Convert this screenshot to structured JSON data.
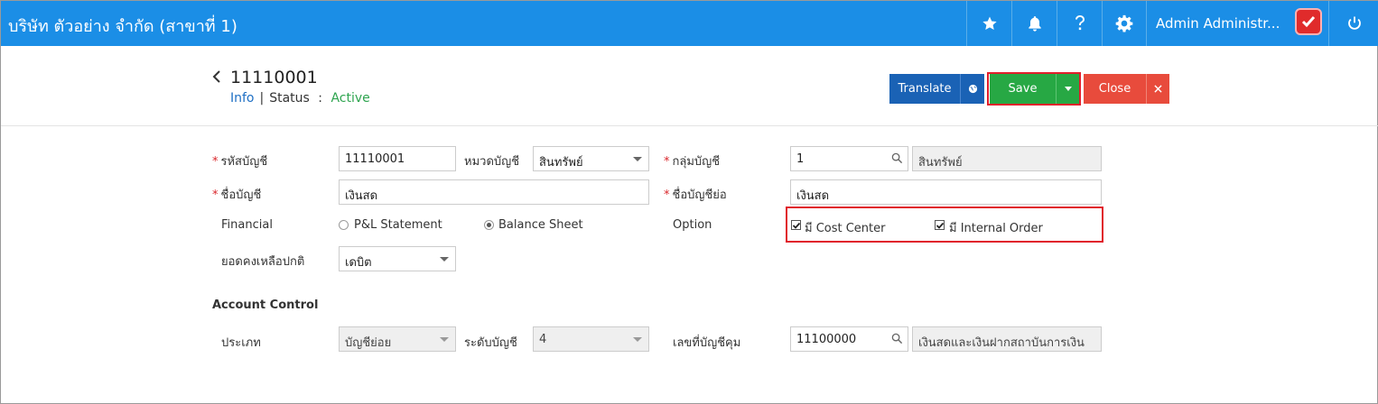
{
  "app": {
    "company_name": "บริษัท ตัวอย่าง จำกัด (สาขาที่ 1)",
    "user_name": "Admin Administr..."
  },
  "header": {
    "doc_number": "11110001",
    "info_label": "Info",
    "separator": "|",
    "status_label": "Status",
    "status_colon": ":",
    "status_value": "Active"
  },
  "actions": {
    "translate_label": "Translate",
    "save_label": "Save",
    "close_label": "Close"
  },
  "form": {
    "account_code": {
      "label": "รหัสบัญชี",
      "value": "11110001"
    },
    "account_category": {
      "label": "หมวดบัญชี",
      "value": "สินทรัพย์"
    },
    "account_group": {
      "label": "กลุ่มบัญชี",
      "value": "1",
      "desc": "สินทรัพย์"
    },
    "account_name": {
      "label": "ชื่อบัญชี",
      "value": "เงินสด"
    },
    "account_short_name": {
      "label": "ชื่อบัญชีย่อ",
      "value": "เงินสด"
    },
    "financial": {
      "label": "Financial",
      "options": [
        "P&L Statement",
        "Balance Sheet"
      ],
      "selected": "Balance Sheet"
    },
    "option": {
      "label": "Option",
      "cost_center": {
        "label": "มี Cost Center",
        "checked": true
      },
      "internal_order": {
        "label": "มี Internal Order",
        "checked": true
      }
    },
    "normal_balance": {
      "label": "ยอดคงเหลือปกติ",
      "value": "เดบิต"
    },
    "required_mark": "*"
  },
  "account_control": {
    "title": "Account Control",
    "type": {
      "label": "ประเภท",
      "value": "บัญชีย่อย"
    },
    "level": {
      "label": "ระดับบัญชี",
      "value": "4"
    },
    "control_account": {
      "label": "เลขที่บัญชีคุม",
      "value": "11100000",
      "desc": "เงินสดและเงินฝากสถาบันการเงิน"
    }
  },
  "colors": {
    "topbar": "#1b8ee6",
    "translate": "#1a62b5",
    "save": "#27a844",
    "close": "#e84b3c",
    "highlight": "#e01e2b"
  }
}
